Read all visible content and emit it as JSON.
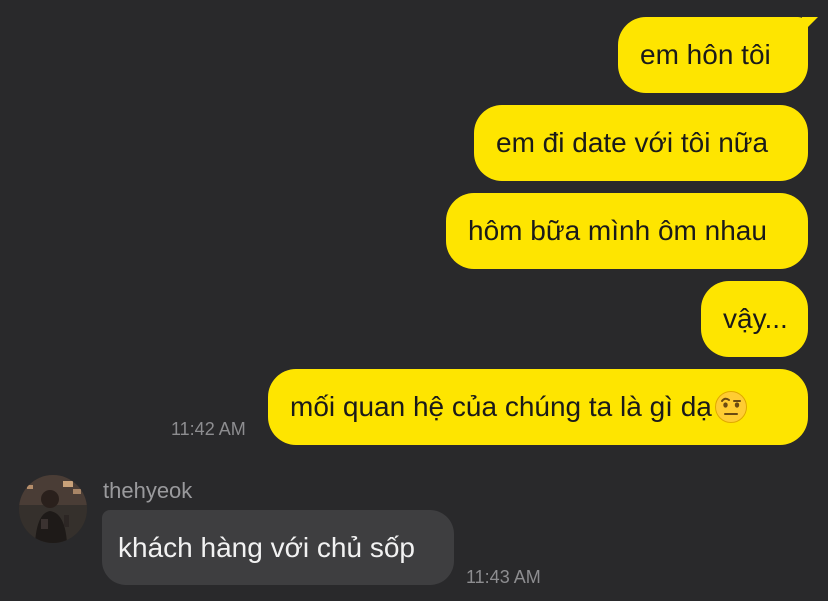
{
  "chat": {
    "outgoing": [
      {
        "text": "em hôn tôi"
      },
      {
        "text": "em đi date với tôi nữa"
      },
      {
        "text": "hôm bữa mình ôm nhau"
      },
      {
        "text": "vậy..."
      },
      {
        "text": "mối quan hệ của chúng ta là gì dạ",
        "emoji": "raised-eyebrow-emoji"
      }
    ],
    "outgoing_time": "11:42 AM",
    "incoming": {
      "sender": "thehyeok",
      "avatar": "profile-photo",
      "text": "khách hàng với chủ sốp",
      "time": "11:43 AM"
    }
  },
  "colors": {
    "background": "#29292b",
    "outgoing_bubble": "#fee500",
    "incoming_bubble": "#3e3e40",
    "timestamp": "#8d8d90"
  }
}
